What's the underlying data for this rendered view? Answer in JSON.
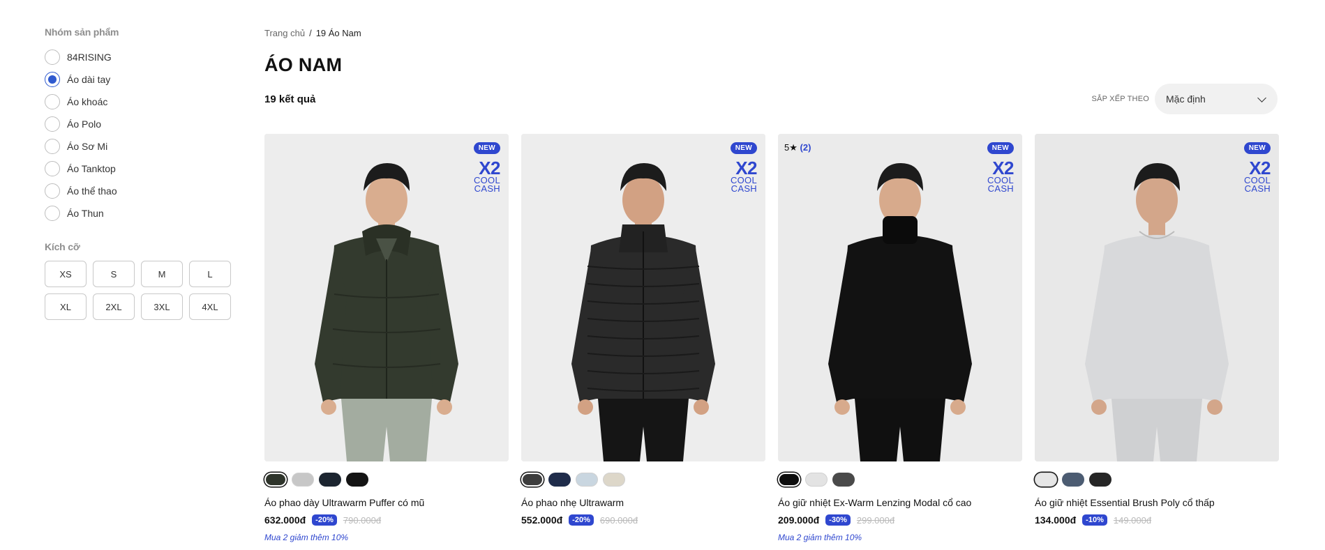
{
  "sidebar": {
    "group_title": "Nhóm sản phẩm",
    "groups": [
      {
        "label": "84RISING",
        "checked": false
      },
      {
        "label": "Áo dài tay",
        "checked": true
      },
      {
        "label": "Áo khoác",
        "checked": false
      },
      {
        "label": "Áo Polo",
        "checked": false
      },
      {
        "label": "Áo Sơ Mi",
        "checked": false
      },
      {
        "label": "Áo Tanktop",
        "checked": false
      },
      {
        "label": "Áo thể thao",
        "checked": false
      },
      {
        "label": "Áo Thun",
        "checked": false
      }
    ],
    "size_title": "Kích cỡ",
    "sizes": [
      "XS",
      "S",
      "M",
      "L",
      "XL",
      "2XL",
      "3XL",
      "4XL"
    ]
  },
  "breadcrumb": {
    "home": "Trang chủ",
    "separator": "/",
    "current": "19 Áo Nam"
  },
  "page_title": "ÁO NAM",
  "result_count": "19 kết quả",
  "sort": {
    "label": "SẮP XẾP THEO",
    "value": "Mặc định"
  },
  "colors": {
    "accent": "#2f47cf",
    "radio_checked": "#2f5acf"
  },
  "products": [
    {
      "badge": "NEW",
      "cashback": {
        "x2": "X2",
        "line1": "COOL",
        "line2": "CASH"
      },
      "rating": null,
      "swatches": [
        "#2e342b",
        "#c7c7c7",
        "#1c2530",
        "#141414"
      ],
      "selected_swatch": 0,
      "name": "Áo phao dày Ultrawarm Puffer có mũ",
      "price": "632.000đ",
      "discount": "-20%",
      "old_price": "790.000đ",
      "promo": "Mua 2 giảm thêm 10%",
      "image": {
        "garment": "#333a2e",
        "pants": "#a3aca0",
        "skin": "#d9ad8f",
        "bg": "#ededed",
        "style": "hoodie-puffer"
      }
    },
    {
      "badge": "NEW",
      "cashback": {
        "x2": "X2",
        "line1": "COOL",
        "line2": "CASH"
      },
      "rating": null,
      "swatches": [
        "#3d3d3d",
        "#1f2c4a",
        "#c9d6e0",
        "#ddd7c9"
      ],
      "selected_swatch": 0,
      "name": "Áo phao nhẹ Ultrawarm",
      "price": "552.000đ",
      "discount": "-20%",
      "old_price": "690.000đ",
      "promo": "",
      "image": {
        "garment": "#2a2a2a",
        "pants": "#151515",
        "skin": "#d2a183",
        "bg": "#ededed",
        "style": "puffer"
      }
    },
    {
      "badge": "NEW",
      "cashback": {
        "x2": "X2",
        "line1": "COOL",
        "line2": "CASH"
      },
      "rating": {
        "value": "5",
        "star": "★",
        "count": "(2)"
      },
      "swatches": [
        "#0e0e0e",
        "#e3e3e3",
        "#4a4a4a"
      ],
      "selected_swatch": 0,
      "name": "Áo giữ nhiệt Ex-Warm Lenzing Modal cổ cao",
      "price": "209.000đ",
      "discount": "-30%",
      "old_price": "299.000đ",
      "promo": "Mua 2 giảm thêm 10%",
      "image": {
        "garment": "#121212",
        "pants": "#101010",
        "skin": "#d7aa8c",
        "bg": "#ebebeb",
        "style": "turtleneck"
      }
    },
    {
      "badge": "NEW",
      "cashback": {
        "x2": "X2",
        "line1": "COOL",
        "line2": "CASH"
      },
      "rating": null,
      "swatches": [
        "#e6e6e6",
        "#4c5c72",
        "#262626"
      ],
      "selected_swatch": 0,
      "name": "Áo giữ nhiệt Essential Brush Poly cổ thấp",
      "price": "134.000đ",
      "discount": "-10%",
      "old_price": "149.000đ",
      "promo": "",
      "image": {
        "garment": "#d8d9db",
        "pants": "#cfd0d2",
        "skin": "#d3a68a",
        "bg": "#e8e8e8",
        "style": "tee"
      }
    }
  ]
}
